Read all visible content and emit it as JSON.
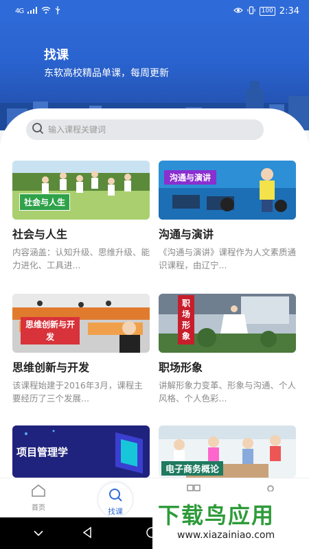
{
  "status_bar": {
    "network": "4G",
    "battery": "100",
    "time": "2:34"
  },
  "header": {
    "title": "找课",
    "subtitle": "东软高校精品单课，每周更新"
  },
  "search": {
    "placeholder": "输入课程关键词"
  },
  "courses": [
    {
      "tag": "社会与人生",
      "title": "社会与人生",
      "desc": "内容涵盖：认知升级、思维升级、能力进化、工具进..."
    },
    {
      "tag": "沟通与演讲",
      "title": "沟通与演讲",
      "desc": "《沟通与演讲》课程作为人文素质通识课程，由辽宁..."
    },
    {
      "tag": "思维创新与开发",
      "title": "思维创新与开发",
      "desc": "该课程始建于2016年3月，课程主要经历了三个发展..."
    },
    {
      "tag": "职场形象",
      "title": "职场形象",
      "desc": "讲解形象力变革、形象与沟通、个人风格、个人色彩..."
    },
    {
      "tag": "项目管理学"
    },
    {
      "tag": "电子商务概论"
    }
  ],
  "bottom_nav": {
    "home": "首页",
    "find_course": "找课"
  },
  "watermark": {
    "main": "下载鸟应用",
    "url": "www.xiazainiao.com"
  },
  "colors": {
    "primary": "#2f6bd8",
    "header_bg": "#2a64d0",
    "watermark_green": "#2e9b3a"
  }
}
